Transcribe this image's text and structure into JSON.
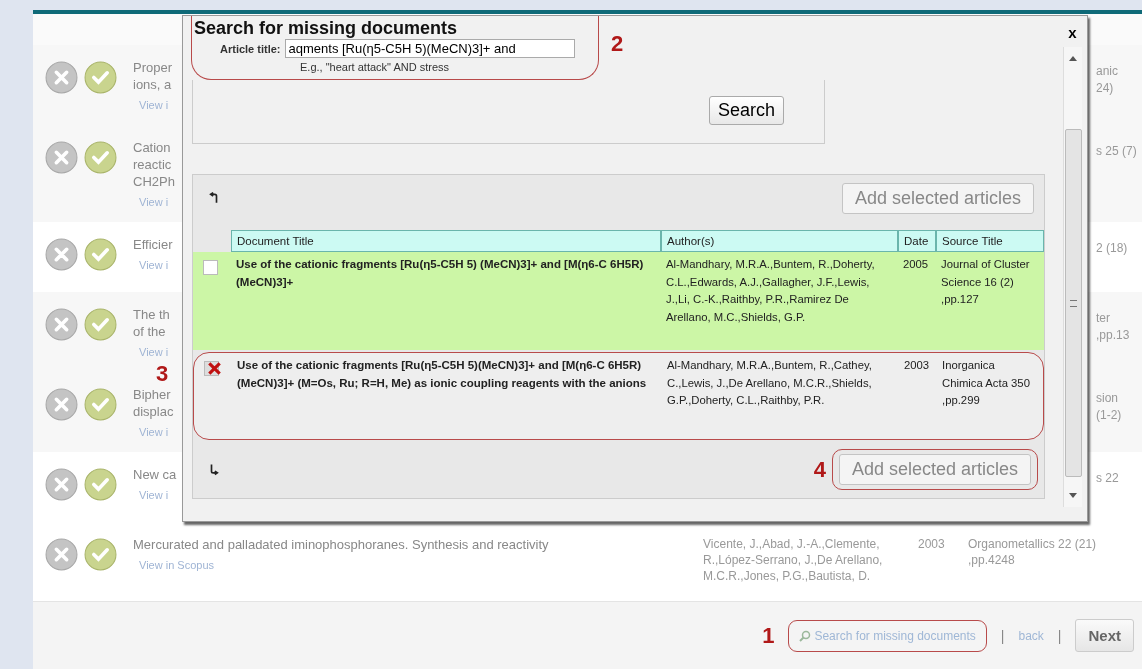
{
  "background_rows": [
    {
      "title_lines": [
        "Proper",
        "ions, a"
      ],
      "link": "View i",
      "source_lines": [
        "anic",
        "24)"
      ]
    },
    {
      "title_lines": [
        "Cation",
        "reactic",
        "CH2Ph"
      ],
      "link": "View i",
      "source_lines": [
        "s 25 (7)"
      ]
    },
    {
      "title_lines": [
        "Efficier"
      ],
      "link": "View i",
      "source_lines": [
        "2 (18)"
      ]
    },
    {
      "title_lines": [
        "The th",
        "of the"
      ],
      "link": "View i",
      "source_lines": [
        "ter",
        ",pp.13"
      ]
    },
    {
      "title_lines": [
        "Bipher",
        "displac"
      ],
      "link": "View i",
      "source_lines": [
        "sion",
        "(1-2)"
      ]
    },
    {
      "title_lines": [
        "New ca"
      ],
      "link": "View i",
      "source_lines": [
        "s 22"
      ]
    }
  ],
  "last_row": {
    "title": "Mercurated and palladated iminophosphoranes. Synthesis and reactivity",
    "link": "View in Scopus",
    "authors": "Vicente, J.,Abad, J.-A.,Clemente, R.,López-Serrano, J.,De Arellano, M.C.R.,Jones, P.G.,Bautista, D.",
    "date": "2003",
    "source": "Organometallics 22 (21) ,pp.4248"
  },
  "footer": {
    "annotation": "1",
    "search_link": "Search for missing documents",
    "separator_1": "|",
    "back": "back",
    "separator_2": "|",
    "next": "Next"
  },
  "dialog": {
    "title": "Search for missing documents",
    "close": "x",
    "annotation": "2",
    "field_label": "Article title:",
    "field_value": "aqments [Ru(η5-C5H 5)(MeCN)3]+ and",
    "hint": "E.g., \"heart attack\" AND stress",
    "search_button": "Search",
    "add_button_top": "Add selected articles",
    "columns": [
      "Document Title",
      "Author(s)",
      "Date",
      "Source Title"
    ],
    "rows": [
      {
        "checked": false,
        "highlighted": true,
        "outlined": false,
        "title": "Use of the cationic fragments [Ru(η5-C5H 5) (MeCN)3]+ and [M(η6-C 6H5R)(MeCN)3]+",
        "authors": "Al-Mandhary, M.R.A.,Buntem, R.,Doherty, C.L.,Edwards, A.J.,Gallagher, J.F.,Lewis, J.,Li, C.-K.,Raithby, P.R.,Ramirez De Arellano, M.C.,Shields, G.P.",
        "date": "2005",
        "source": "Journal of Cluster Science 16 (2) ,pp.127"
      },
      {
        "checked": true,
        "highlighted": false,
        "outlined": true,
        "annotation": "3",
        "title": "Use of the cationic fragments [Ru(η5-C5H 5)(MeCN)3]+ and [M(η6-C 6H5R)(MeCN)3]+ (M=Os, Ru; R=H, Me) as ionic coupling reagents with the anions",
        "authors": "Al-Mandhary, M.R.A.,Buntem, R.,Cathey, C.,Lewis, J.,De Arellano, M.C.R.,Shields, G.P.,Doherty, C.L.,Raithby, P.R.",
        "date": "2003",
        "source": "Inorganica Chimica Acta 350 ,pp.299"
      }
    ],
    "bottom_annotation": "4",
    "add_button_bottom": "Add selected articles"
  }
}
